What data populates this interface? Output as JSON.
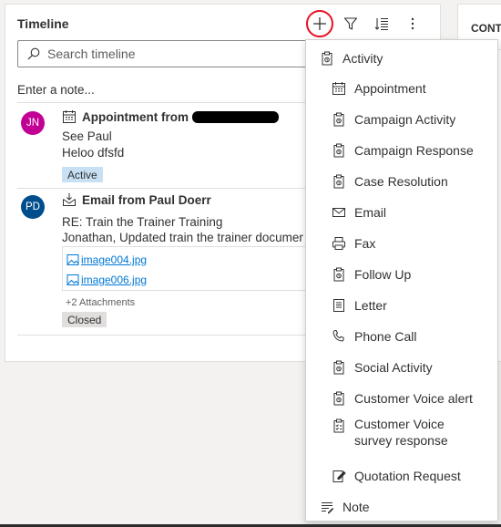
{
  "timeline": {
    "title": "Timeline",
    "search_placeholder": "Search timeline",
    "note_placeholder": "Enter a note...",
    "records": [
      {
        "avatar_initials": "JN",
        "avatar_color": "#c30094",
        "type_icon": "calendar-icon",
        "title": "Appointment from",
        "line1": "See Paul",
        "line2": "Heloo dfsfd",
        "status": "Active"
      },
      {
        "avatar_initials": "PD",
        "avatar_color": "#004e8c",
        "type_icon": "email-received-icon",
        "title": "Email from Paul Doerr",
        "line1": "RE: Train the Trainer Training",
        "line2": "Jonathan,   Updated train the trainer documer",
        "attachments": [
          "image004.jpg",
          "image006.jpg"
        ],
        "more_attachments": "+2 Attachments",
        "status": "Closed"
      }
    ]
  },
  "right_panel": {
    "title": "CONT"
  },
  "menu": {
    "items": [
      {
        "label": "Activity",
        "icon": "clipboard-icon",
        "level": "top"
      },
      {
        "label": "Appointment",
        "icon": "calendar-icon",
        "level": "sub"
      },
      {
        "label": "Campaign Activity",
        "icon": "clipboard-icon",
        "level": "sub"
      },
      {
        "label": "Campaign Response",
        "icon": "clipboard-icon",
        "level": "sub"
      },
      {
        "label": "Case Resolution",
        "icon": "clipboard-icon",
        "level": "sub"
      },
      {
        "label": "Email",
        "icon": "envelope-icon",
        "level": "sub"
      },
      {
        "label": "Fax",
        "icon": "fax-icon",
        "level": "sub"
      },
      {
        "label": "Follow Up",
        "icon": "clipboard-icon",
        "level": "sub"
      },
      {
        "label": "Letter",
        "icon": "letter-icon",
        "level": "sub"
      },
      {
        "label": "Phone Call",
        "icon": "phone-icon",
        "level": "sub"
      },
      {
        "label": "Social Activity",
        "icon": "clipboard-icon",
        "level": "sub"
      },
      {
        "label": "Customer Voice alert",
        "icon": "clipboard-icon",
        "level": "sub"
      },
      {
        "label": "Customer Voice survey response",
        "icon": "survey-icon",
        "level": "sub"
      },
      {
        "label": "Quotation Request",
        "icon": "quote-edit-icon",
        "level": "sub"
      },
      {
        "label": "Note",
        "icon": "note-icon",
        "level": "top"
      }
    ]
  },
  "colors": {
    "accent": "#0078d4",
    "highlight_ring": "#e81123",
    "active_badge": "#c7e0f4",
    "closed_badge": "#e1dfdd"
  }
}
